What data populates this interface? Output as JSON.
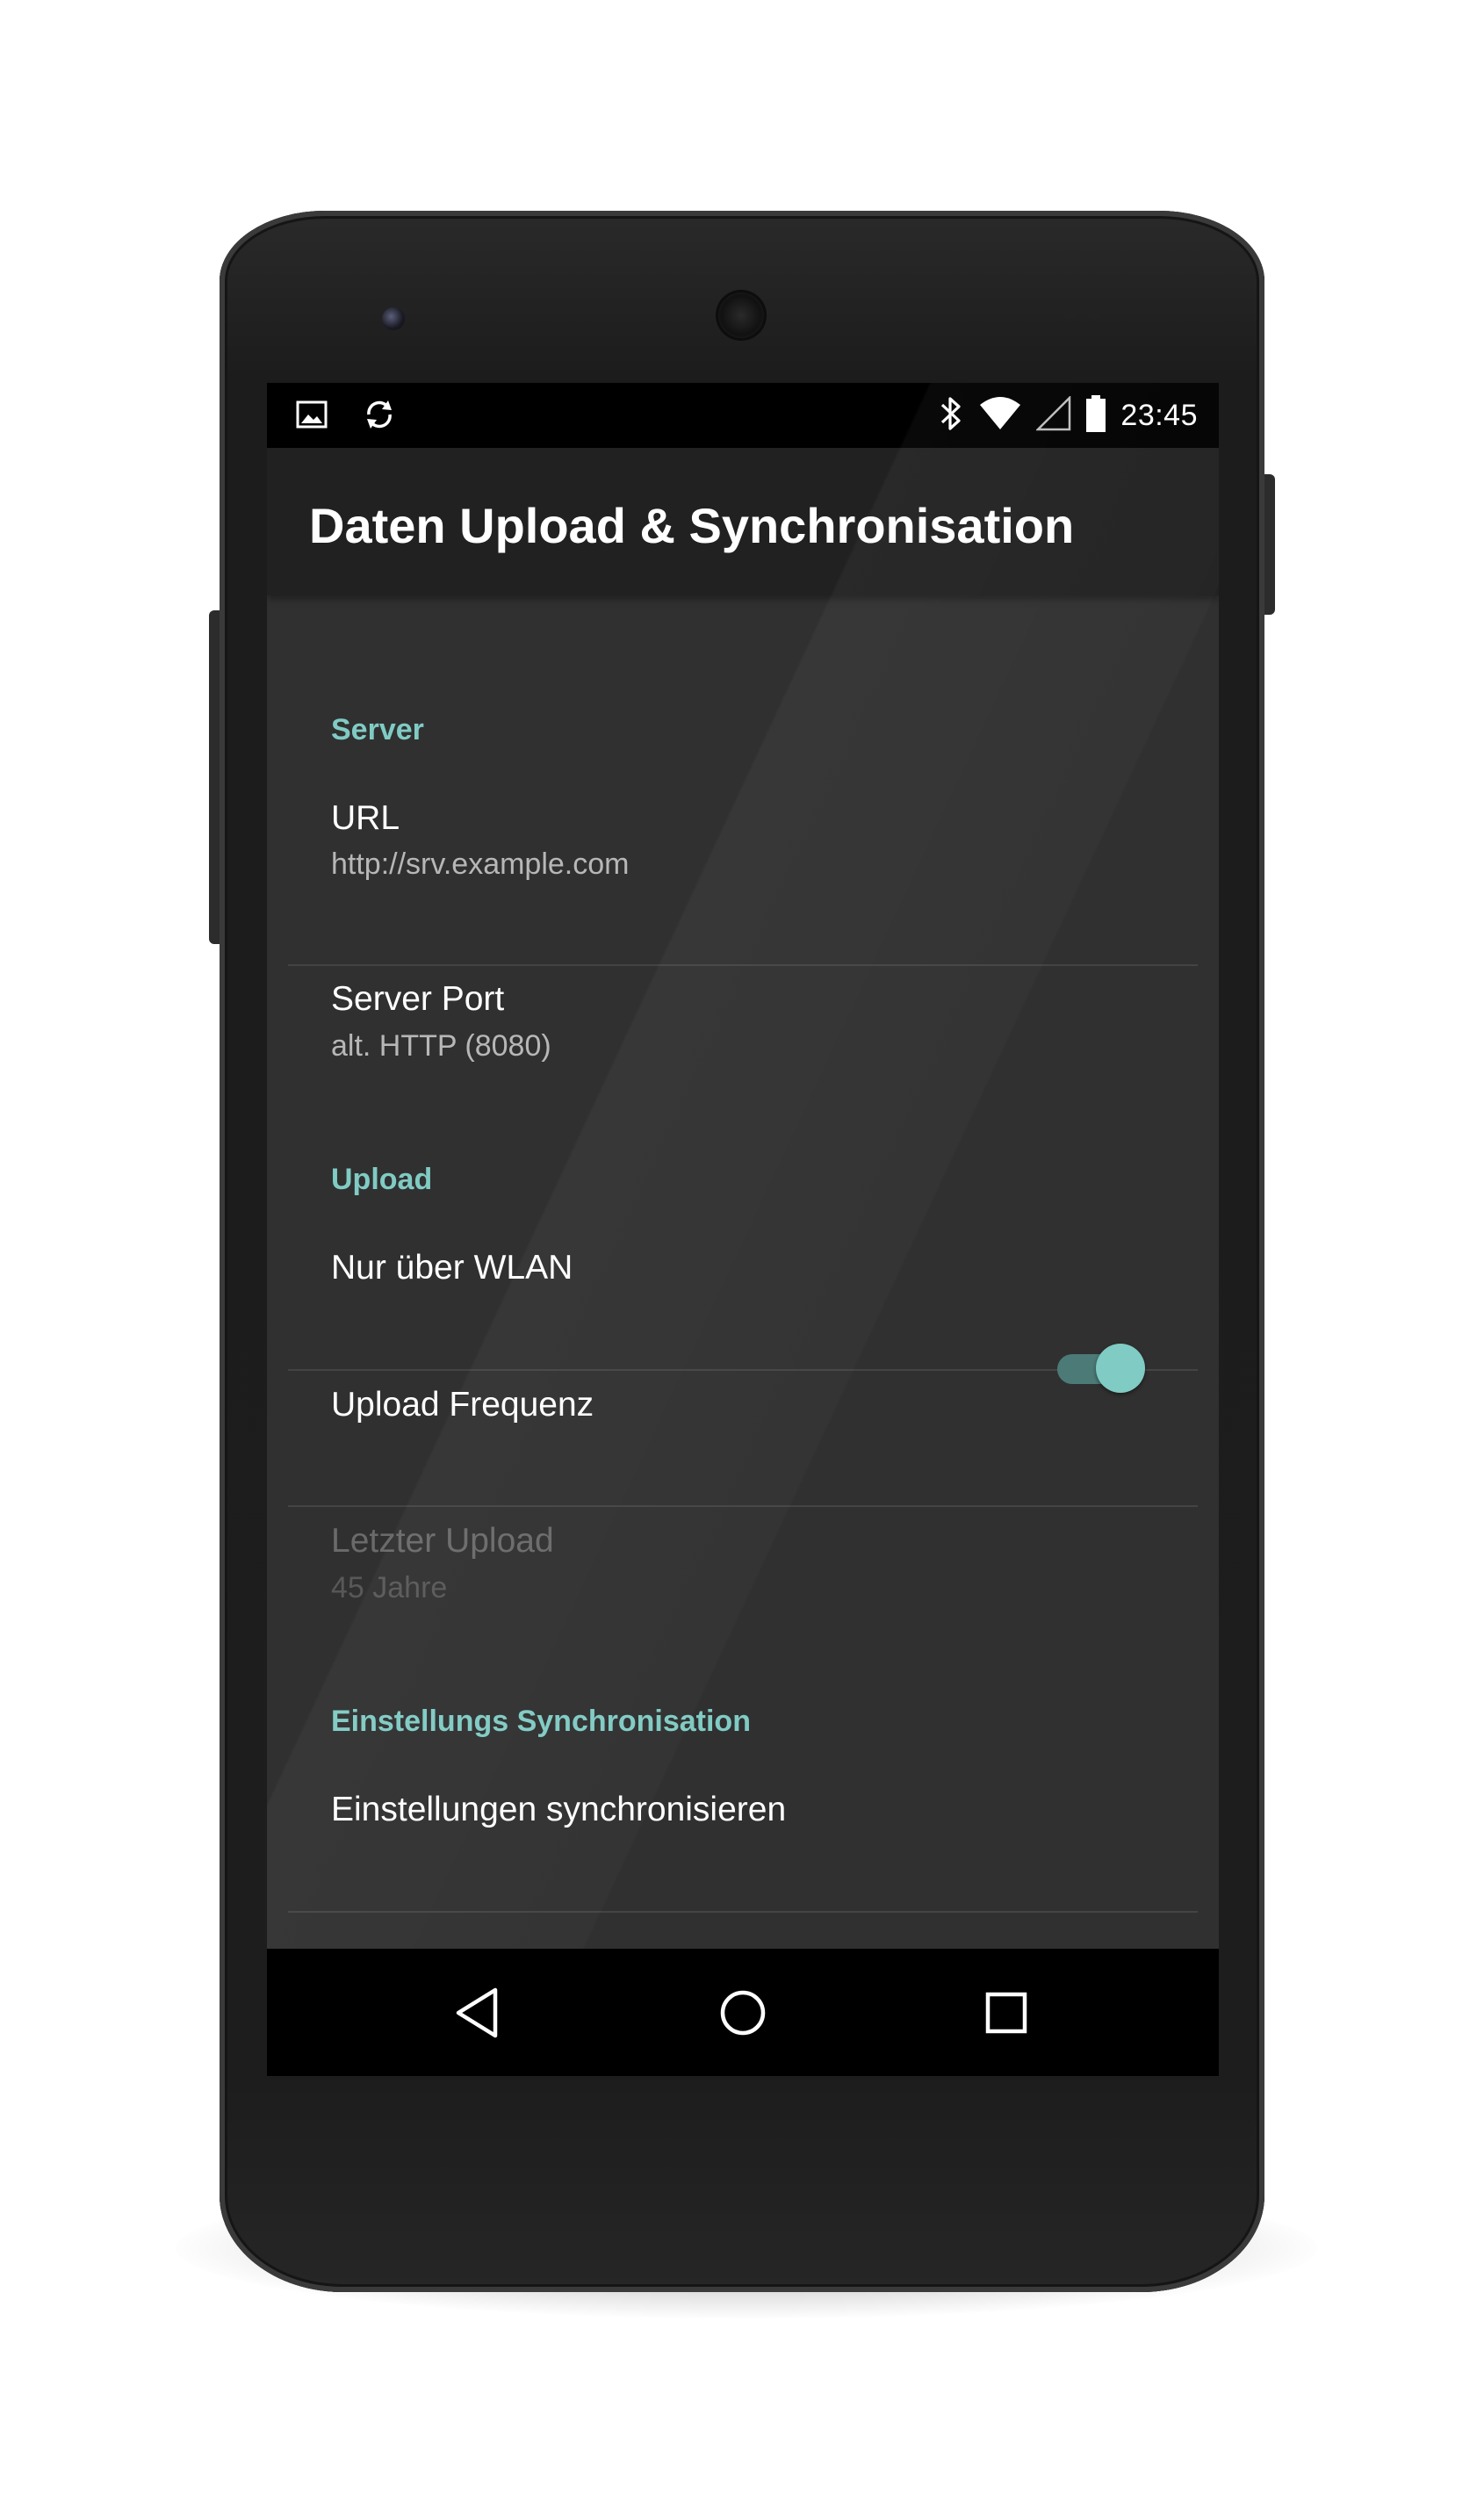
{
  "status_bar": {
    "time": "23:45",
    "left_icons": [
      "image-icon",
      "sync-icon"
    ],
    "right_icons": [
      "bluetooth-icon",
      "wifi-icon",
      "cell-signal-icon",
      "battery-icon"
    ]
  },
  "app_bar": {
    "title": "Daten Upload & Synchronisation"
  },
  "sections": {
    "server": {
      "header": "Server",
      "url": {
        "title": "URL",
        "summary": "http://srv.example.com"
      },
      "port": {
        "title": "Server Port",
        "summary": "alt. HTTP (8080)"
      }
    },
    "upload": {
      "header": "Upload",
      "wifi_only": {
        "title": "Nur über WLAN",
        "enabled": true
      },
      "frequency": {
        "title": "Upload Frequenz"
      },
      "last_upload": {
        "title": "Letzter Upload",
        "summary": "45 Jahre",
        "disabled": true
      }
    },
    "settings_sync": {
      "header": "Einstellungs Synchronisation",
      "sync_now": {
        "title": "Einstellungen synchronisieren"
      }
    }
  },
  "nav_bar": {
    "buttons": [
      "back-icon",
      "home-icon",
      "recents-icon"
    ]
  },
  "colors": {
    "accent": "#80cbc4",
    "background": "#303030",
    "app_bar": "#212121"
  }
}
